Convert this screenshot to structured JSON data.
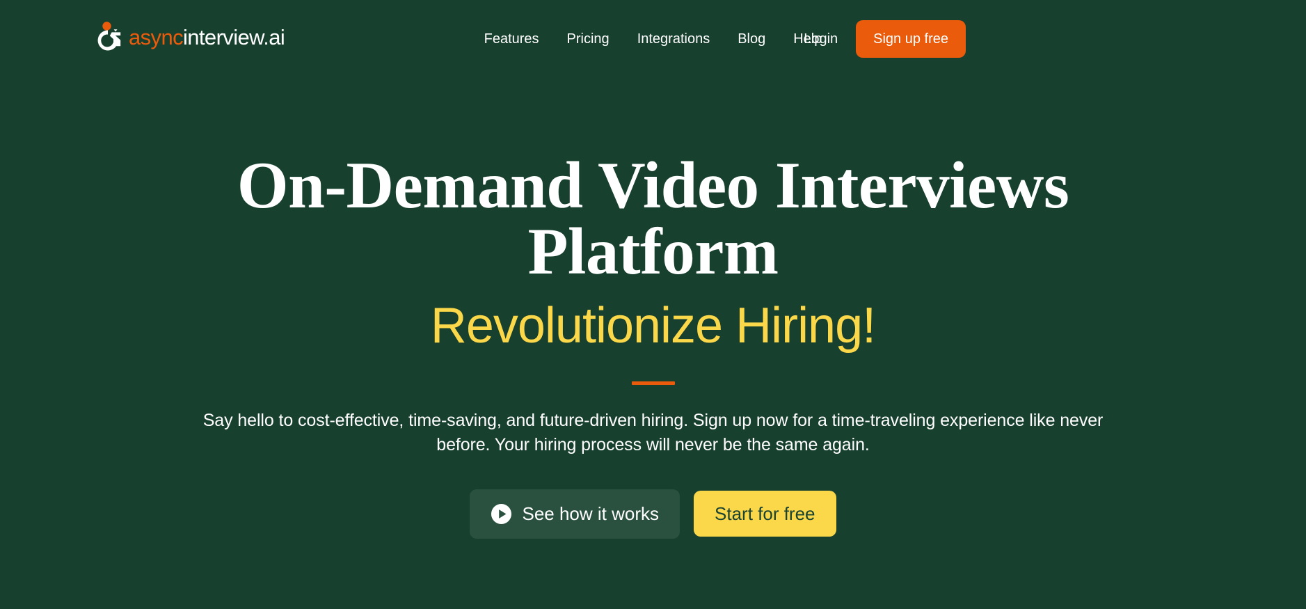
{
  "theme": {
    "background": "#18402F",
    "accent_orange": "#EA5B0C",
    "accent_yellow": "#FBD84A",
    "text_white": "#FFFFFF",
    "secondary_button_bg": "#2A5140"
  },
  "header": {
    "brand": {
      "logo_icon": "asyncinterview-logo-icon",
      "name_part1": "async",
      "name_part2": "interview.ai"
    },
    "nav": [
      {
        "label": "Features"
      },
      {
        "label": "Pricing"
      },
      {
        "label": "Integrations"
      },
      {
        "label": "Blog"
      },
      {
        "label": "Help"
      }
    ],
    "login_label": "Login",
    "signup_label": "Sign up free"
  },
  "hero": {
    "title": "On-Demand Video Interviews Platform",
    "subtitle": "Revolutionize Hiring!",
    "description": "Say hello to cost-effective, time-saving, and future-driven hiring. Sign up now for a time-traveling experience like never before. Your hiring process will never be the same again.",
    "cta_secondary": {
      "icon": "play-circle-icon",
      "label": "See how it works"
    },
    "cta_primary": {
      "label": "Start for free"
    }
  }
}
